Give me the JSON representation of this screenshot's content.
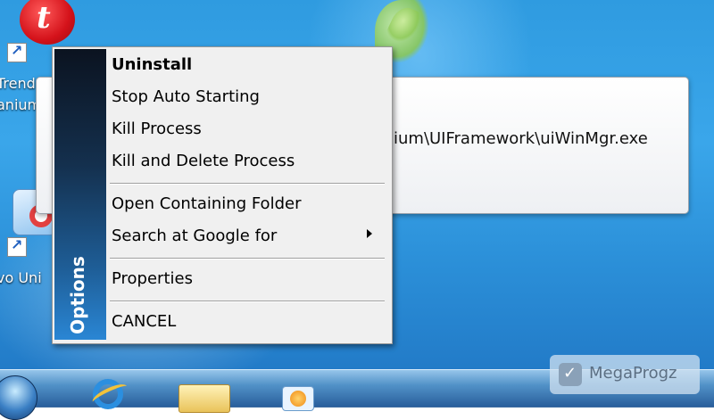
{
  "desktop": {
    "icons": [
      {
        "label": "Trend",
        "label_line2": "anium"
      },
      {
        "label": "vo Uni"
      }
    ]
  },
  "dialog": {
    "path_text": "ium\\UIFramework\\uiWinMgr.exe"
  },
  "context_menu": {
    "banner_label": "Options",
    "items": [
      {
        "label": "Uninstall",
        "bold": true
      },
      {
        "label": "Stop Auto Starting"
      },
      {
        "label": "Kill Process"
      },
      {
        "label": "Kill and Delete Process"
      },
      {
        "label": "Open Containing Folder"
      },
      {
        "label": "Search at Google for",
        "has_submenu": true
      },
      {
        "label": "Properties"
      },
      {
        "label": "CANCEL"
      }
    ]
  },
  "taskbar": {
    "pinned": [
      "start-orb-icon",
      "internet-explorer-icon",
      "file-explorer-folder-icon",
      "media-player-icon"
    ]
  },
  "watermark": {
    "text": "MegaProgz"
  },
  "colors": {
    "banner_top": "#0b1320",
    "banner_bottom": "#2a86d4",
    "menu_bg": "#f0f0f0",
    "desktop_blue": "#2f9be0"
  }
}
